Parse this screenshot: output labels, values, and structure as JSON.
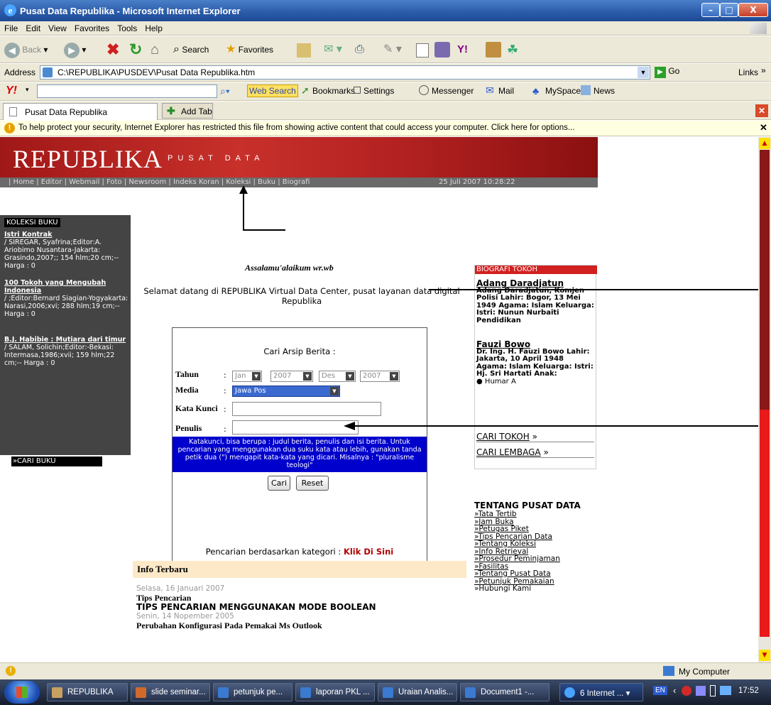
{
  "window": {
    "title": "Pusat Data Republika - Microsoft Internet Explorer",
    "min": "–",
    "max": "□",
    "close": "X"
  },
  "menu": [
    "File",
    "Edit",
    "View",
    "Favorites",
    "Tools",
    "Help"
  ],
  "toolbar": {
    "back": "Back",
    "search": "Search",
    "favorites": "Favorites"
  },
  "address": {
    "label": "Address",
    "value": "C:\\REPUBLIKA\\PUSDEV\\Pusat Data Republika.htm",
    "go": "Go",
    "links": "Links"
  },
  "yahoo": {
    "web_search": "Web Search",
    "bookmarks": "Bookmarks",
    "settings": "Settings",
    "messenger": "Messenger",
    "mail": "Mail",
    "myspace": "MySpace",
    "news": "News"
  },
  "tabs": {
    "active": "Pusat Data Republika",
    "add": "Add Tab"
  },
  "infobar": {
    "text": "To help protect your security, Internet Explorer has restricted this file from showing active content that could access your computer. Click here for options..."
  },
  "page": {
    "logo": "REPUBLIKA",
    "logo_sub": "PUSAT DATA",
    "nav": "| Home | Editor | Webmail | Foto | Newsroom | Indeks Koran | Koleksi | Buku | Biografi",
    "datetime": "25 Juli 2007  10:28:22",
    "greeting": "Assalamu'alaikum wr.wb",
    "welcome": "Selamat datang di REPUBLIKA Virtual Data Center, pusat layanan data digital Republika",
    "koleksi": {
      "title": "KOLEKSI BUKU",
      "books": [
        {
          "title": "Istri Kontrak",
          "desc": "/ SIREGAR, Syafrina;Editor:A. Ariobimo Nusantara-Jakarta: Grasindo,2007;; 154 hlm;20 cm;-- Harga : 0"
        },
        {
          "title": "100 Tokoh yang Mengubah Indonesia",
          "desc": "/ ;Editor:Bernard Siagian-Yogyakarta: Narasi,2006;xvi; 288 hlm;19 cm;-- Harga : 0"
        },
        {
          "title": "B.J. Habibie : Mutiara dari timur",
          "desc": "/ SALAM, Solichin;Editor:-Bekasi: Intermasa,1986;xvii; 159 hlm;22 cm;-- Harga : 0"
        }
      ],
      "cari": "»CARI BUKU"
    },
    "form": {
      "title": "Cari Arsip Berita :",
      "tahun_label": "Tahun",
      "media_label": "Media",
      "kata_label": "Kata Kunci",
      "penulis_label": "Penulis",
      "colon": ":",
      "month_from": "Jan",
      "year_from": "2007",
      "month_to": "Des",
      "year_to": "2007",
      "media": "Jawa Pos",
      "hint": "Katakunci, bisa berupa : judul berita, penulis dan isi berita. Untuk pencarian yang menggunakan dua suku kata atau lebih, gunakan tanda petik dua (\") mengapit kata-kata yang dicari. Misalnya : \"pluralisme teologi\"",
      "cari": "Cari",
      "reset": "Reset",
      "kategori": "Pencarian berdasarkan kategori :",
      "klik": "Klik Di Sini"
    },
    "biografi": {
      "title": "BIOGRAFI TOKOH",
      "p1_name": "Adang Daradjatun",
      "p1_desc": "Adang Daradjatun, Komjen Polisi Lahir: Bogor, 13 Mei 1949 Agama: Islam Keluarga: Istri: Nunun Nurbaiti Pendidikan",
      "p2_name": "Fauzi Bowo",
      "p2_desc": "Dr. Ing. H. Fauzi Bowo Lahir: Jakarta, 10 April 1948 Agama: Islam Keluarga: Istri: Hj. Sri Hartati Anak:",
      "p2_child": "Humar A",
      "cari_tokoh": "CARI TOKOH",
      "cari_lembaga": "CARI LEMBAGA",
      "arrow": "»"
    },
    "tentang": {
      "title": "TENTANG PUSAT DATA",
      "items": [
        "»Tata Tertib",
        "»Jam Buka",
        "»Petugas Piket",
        "»Tips Pencarian Data",
        "»Tentang Koleksi",
        "»Info Retrieval",
        "»Prosedur Peminjaman",
        "»Fasilitas",
        "»Tentang Pusat Data",
        "»Petunjuk Pemakaian",
        "»Hubungi Kami"
      ]
    },
    "info": {
      "title": "Info Terbaru",
      "d1": "Selasa, 16 Januari 2007",
      "h1": "Tips Pencarian",
      "t1": "TIPS PENCARIAN MENGGUNAKAN MODE BOOLEAN",
      "d2": "Senin, 14 Nopember 2005",
      "t2": "Perubahan Konfigurasi Pada Pemakai Ms Outlook"
    }
  },
  "status": {
    "zone": "My Computer"
  },
  "taskbar": {
    "items": [
      "REPUBLIKA",
      "slide seminar...",
      "petunjuk pe...",
      "laporan PKL ...",
      "Uraian Analis...",
      "Document1 -...",
      "6 Internet ..."
    ],
    "lang": "EN",
    "time": "17:52"
  }
}
